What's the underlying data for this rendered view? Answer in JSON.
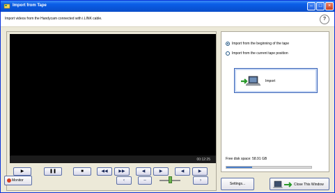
{
  "window": {
    "title": "Import from Tape",
    "minimize": "–",
    "maximize": "□",
    "close": "×"
  },
  "description": "Import videos from the Handycam connected with i.LINK cable.",
  "help": "?",
  "video": {
    "timecode": "00:12:25"
  },
  "controls": {
    "play": "▶",
    "pause": "❚❚",
    "stop": "■",
    "rewind": "◀◀",
    "fast_forward": "▶▶",
    "prev_frame": "◀",
    "next_frame": "▶",
    "slow_back": "◀",
    "slow_forward": "▶",
    "record_label": "Monitor",
    "volume_down": "‹",
    "volume_mid": "–",
    "volume_up": "›"
  },
  "options": {
    "from_beginning": "Import from the beginning of the tape",
    "from_current": "Import from the current tape position",
    "selected": "from_beginning"
  },
  "import_button": {
    "label": "Import"
  },
  "disk": {
    "free_space_text": "Free disk space: 58.91 GB",
    "used_fraction": 0.3
  },
  "buttons": {
    "settings": "Settings...",
    "close_window": "Close This Window"
  }
}
